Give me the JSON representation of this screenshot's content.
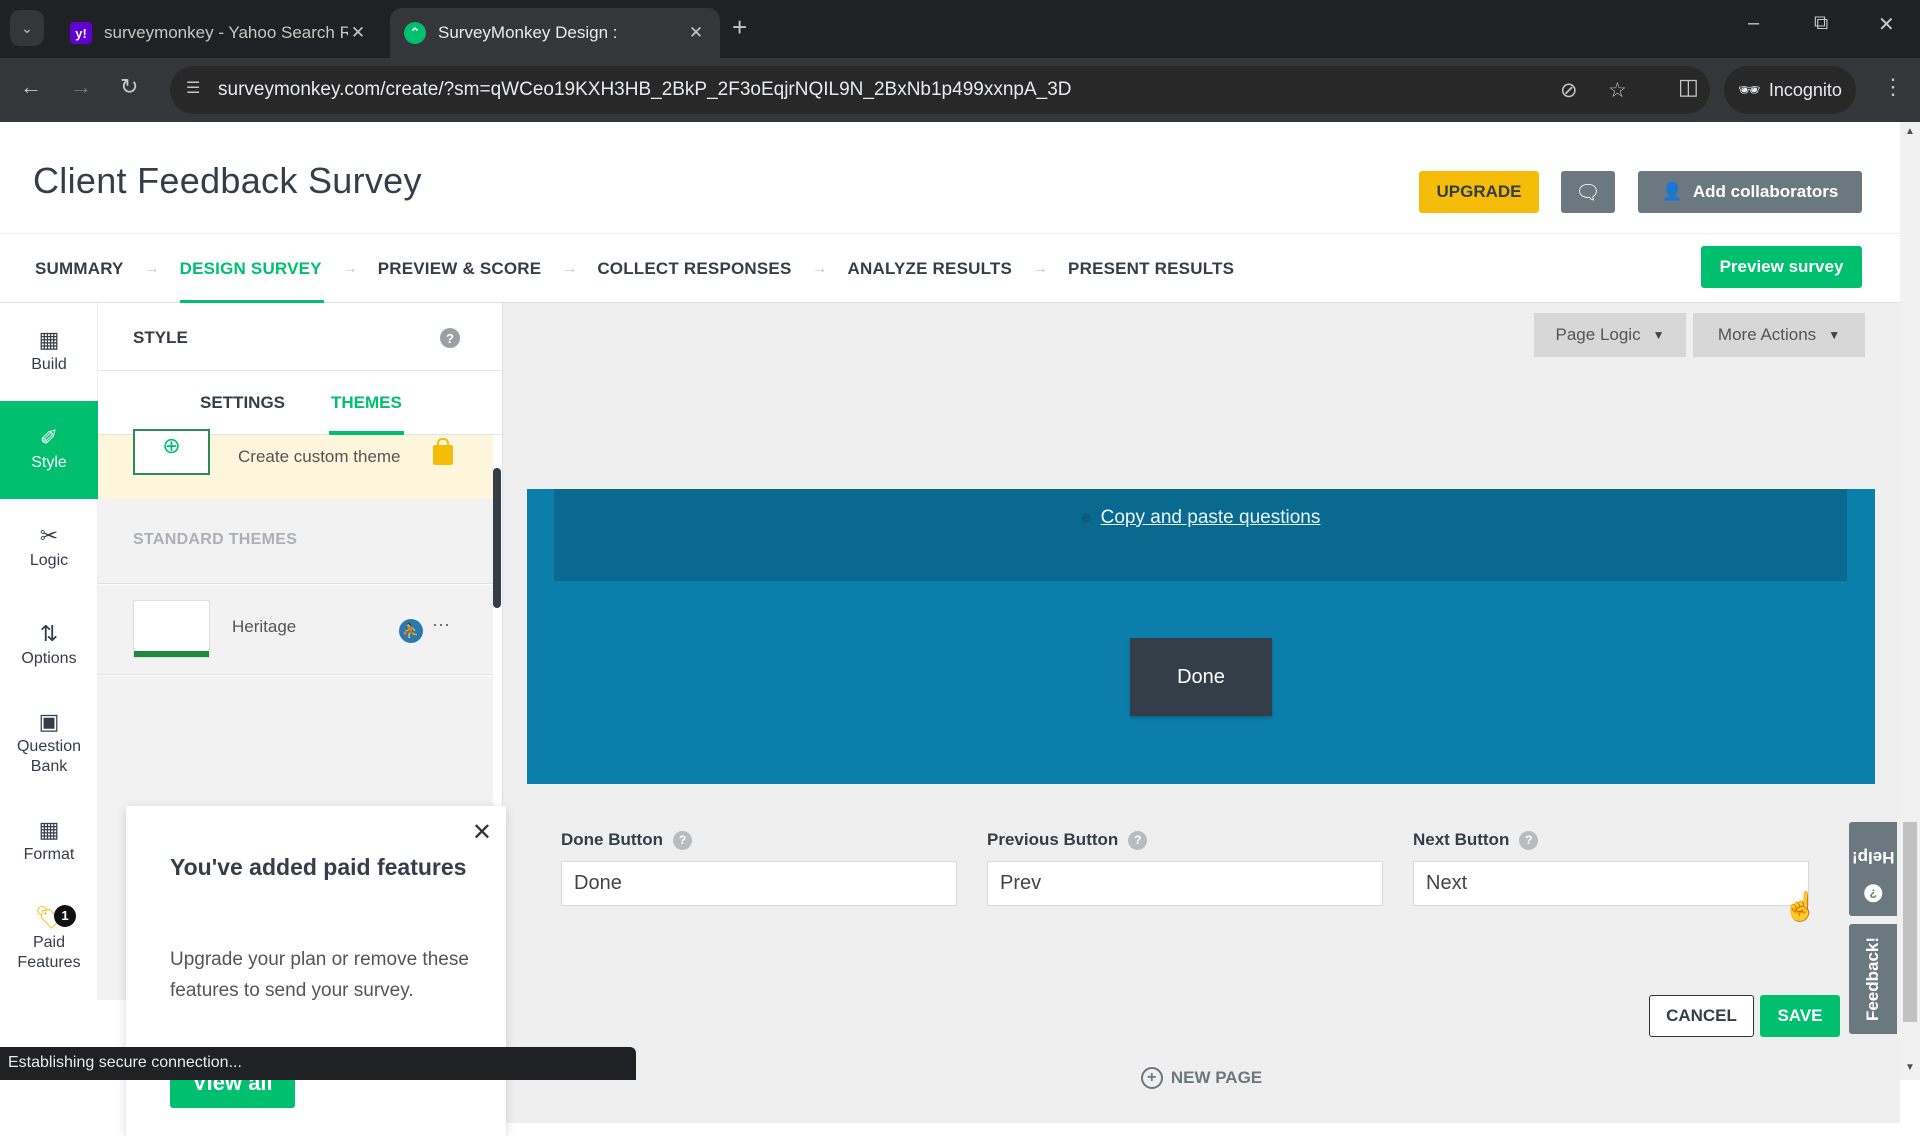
{
  "browser": {
    "tabs": [
      {
        "title": "surveymonkey - Yahoo Search R",
        "favicon": "yahoo-icon",
        "active": false
      },
      {
        "title": "SurveyMonkey Design :",
        "favicon": "surveymonkey-icon",
        "active": true
      }
    ],
    "url": "surveymonkey.com/create/?sm=qWCeo19KXH3HB_2BkP_2F3oEqjrNQIL9N_2BxNb1p499xxnpA_3D",
    "incognito_label": "Incognito",
    "status_text": "Establishing secure connection..."
  },
  "header": {
    "survey_title": "Client Feedback Survey",
    "upgrade_label": "UPGRADE",
    "add_collaborators_label": "Add collaborators"
  },
  "steps": [
    {
      "label": "SUMMARY",
      "active": false
    },
    {
      "label": "DESIGN SURVEY",
      "active": true
    },
    {
      "label": "PREVIEW & SCORE",
      "active": false
    },
    {
      "label": "COLLECT RESPONSES",
      "active": false
    },
    {
      "label": "ANALYZE RESULTS",
      "active": false
    },
    {
      "label": "PRESENT RESULTS",
      "active": false
    }
  ],
  "preview_survey_label": "Preview survey",
  "rail": [
    {
      "label": "Build",
      "icon": "build-icon"
    },
    {
      "label": "Style",
      "icon": "brush-icon",
      "active": true
    },
    {
      "label": "Logic",
      "icon": "logic-icon"
    },
    {
      "label": "Options",
      "icon": "options-icon"
    },
    {
      "label": "Question Bank",
      "icon": "question-bank-icon"
    },
    {
      "label": "Format",
      "icon": "format-icon"
    },
    {
      "label": "Paid Features",
      "icon": "tag-icon",
      "badge": "1"
    }
  ],
  "style_panel": {
    "title": "STYLE",
    "tabs": [
      "SETTINGS",
      "THEMES"
    ],
    "active_tab": "THEMES",
    "create_custom_theme": "Create custom theme",
    "standard_themes_title": "STANDARD THEMES",
    "themes": [
      {
        "name": "Heritage"
      }
    ]
  },
  "popover": {
    "title": "You've added paid features",
    "body": "Upgrade your plan or remove these features to send your survey.",
    "button": "View all"
  },
  "canvas": {
    "page_logic_label": "Page Logic",
    "more_actions_label": "More Actions",
    "copy_paste_link": "Copy and paste questions",
    "done_preview_label": "Done",
    "fields": [
      {
        "label": "Done Button",
        "value": "Done"
      },
      {
        "label": "Previous Button",
        "value": "Prev"
      },
      {
        "label": "Next Button",
        "value": "Next"
      }
    ],
    "cancel_label": "CANCEL",
    "save_label": "SAVE",
    "new_page_label": "NEW PAGE"
  },
  "side_tabs": {
    "help_label": "Help!",
    "feedback_label": "Feedback!"
  },
  "colors": {
    "brand_green": "#00bf6f",
    "upgrade_yellow": "#f5bd0a",
    "theme_blue": "#0b7eab",
    "dark_slate": "#333e48"
  }
}
